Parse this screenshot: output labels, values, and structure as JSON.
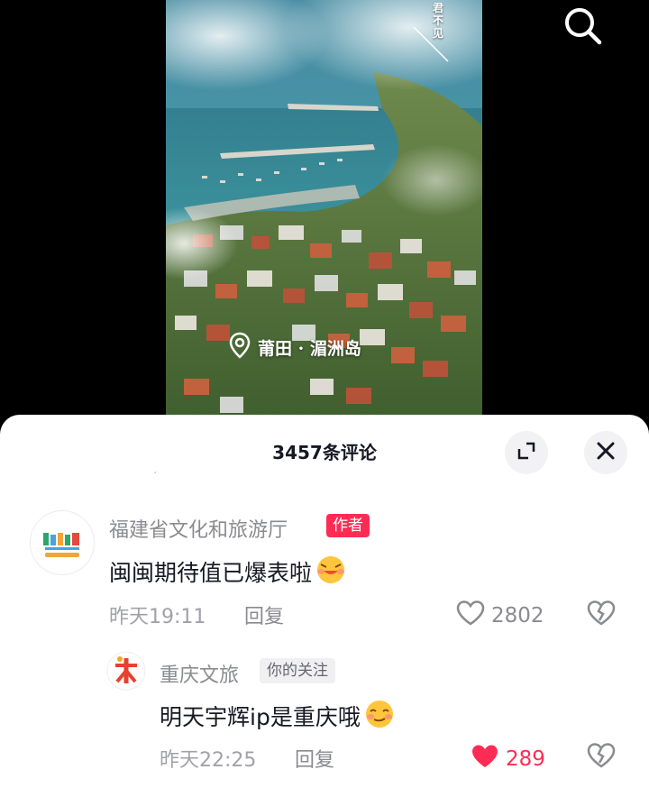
{
  "video": {
    "location_text": "莆田 · 湄洲岛",
    "vertical_text": "君不见"
  },
  "sheet": {
    "title": "3457条评论",
    "ghost_text": "·"
  },
  "comments": [
    {
      "avatar": "avatar-logo",
      "user": "福建省文化和旅游厅",
      "badge": "作者",
      "text": "闽闽期待值已爆表啦",
      "time": "昨天19:11",
      "reply_label": "回复",
      "likes": "2802",
      "liked": false
    },
    {
      "avatar": "avatar-logo",
      "user": "重庆文旅",
      "badge": "你的关注",
      "text": "明天宇辉ip是重庆哦",
      "time": "昨天22:25",
      "reply_label": "回复",
      "likes": "289",
      "liked": true
    }
  ],
  "colors": {
    "accent": "#fe2c55",
    "text": "#161823",
    "muted": "#8a8b91"
  }
}
